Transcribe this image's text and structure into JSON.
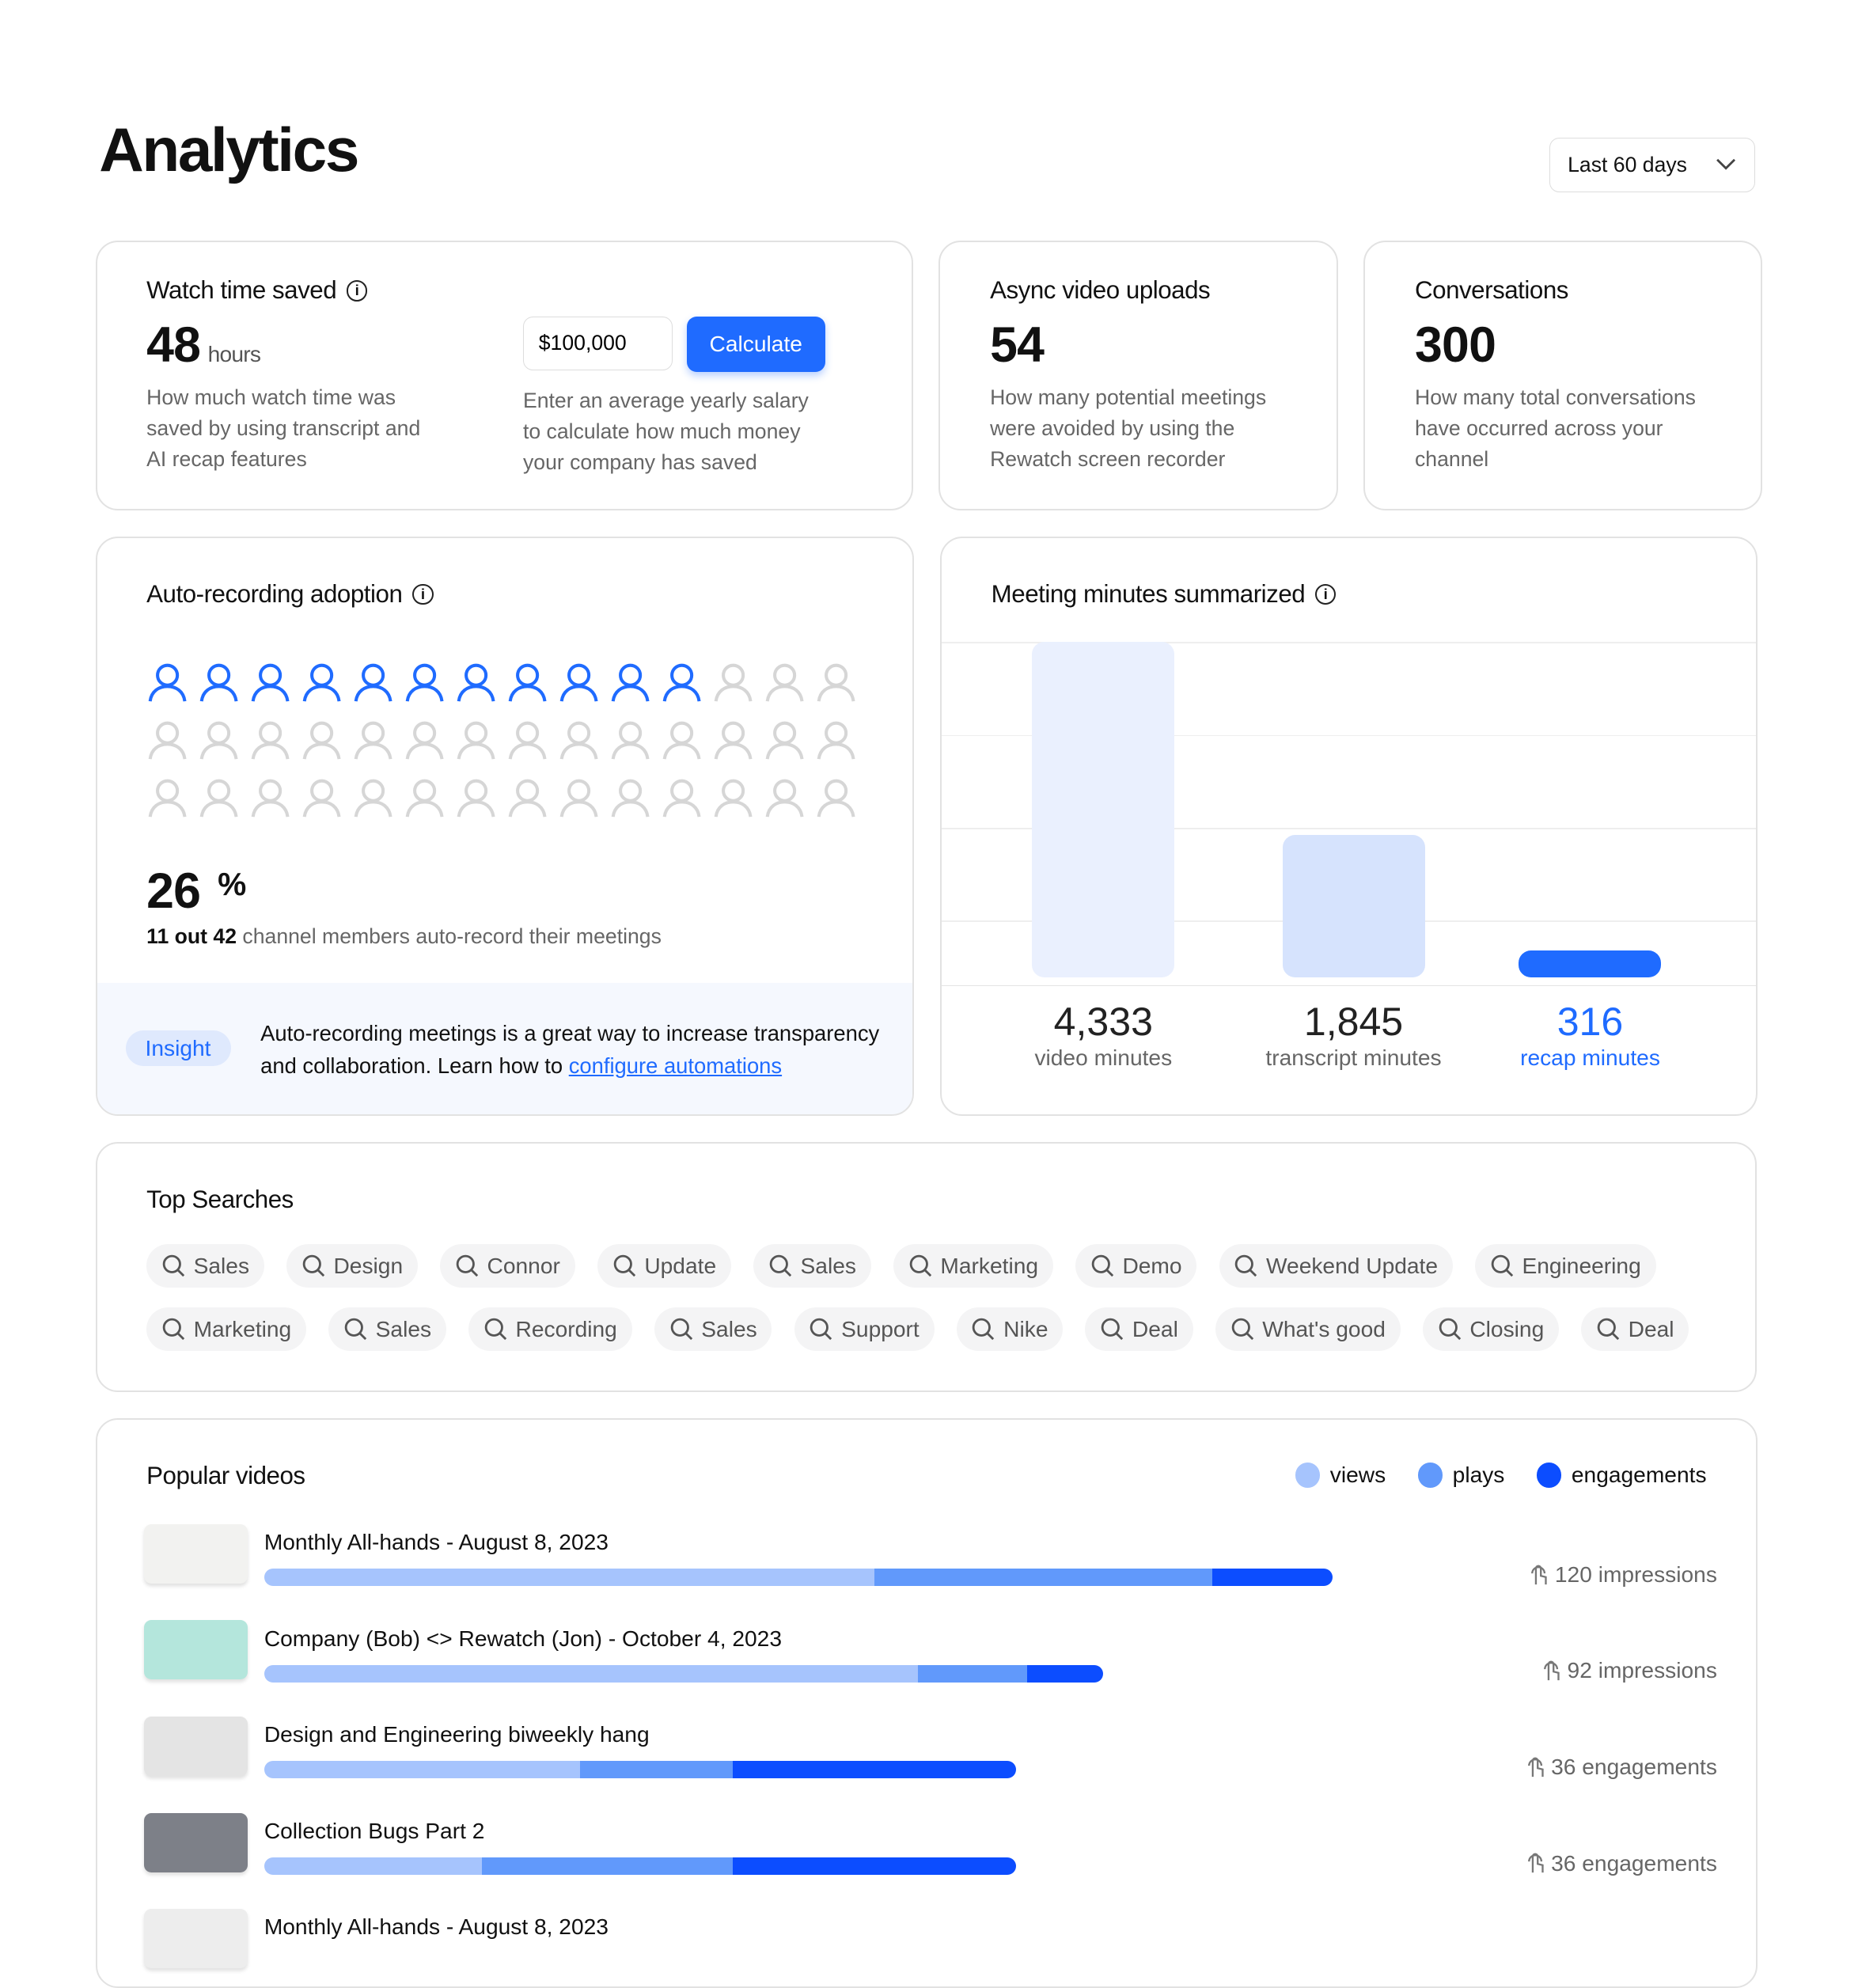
{
  "header": {
    "title": "Analytics",
    "range": "Last 60 days"
  },
  "watch": {
    "title": "Watch time saved",
    "value": "48",
    "unit": "hours",
    "desc": "How much watch time was saved by using transcript and AI recap features",
    "salary": "$100,000",
    "calculate": "Calculate",
    "calc_desc": "Enter an average yearly salary to calculate how much money your company has saved"
  },
  "uploads": {
    "title": "Async video uploads",
    "value": "54",
    "desc": "How many potential meetings were avoided by using the Rewatch screen recorder"
  },
  "conversations": {
    "title": "Conversations",
    "value": "300",
    "desc": "How many total conversations have occurred across your channel"
  },
  "adoption": {
    "title": "Auto-recording adoption",
    "percent": "26",
    "percent_sign": "%",
    "active": 11,
    "total": 42,
    "count_text": "11 out 42",
    "count_suffix": "channel members auto-record their meetings",
    "insight_badge": "Insight",
    "insight_text": "Auto-recording meetings is a great way to increase transparency and collaboration. Learn how to",
    "insight_link": "configure automations",
    "active_color": "#1f6bff",
    "inactive_color": "#d6d6d6"
  },
  "minutes": {
    "title": "Meeting minutes summarized",
    "items": [
      {
        "value": 4333,
        "value_label": "4,333",
        "label": "video minutes",
        "color": "#eaf0fe"
      },
      {
        "value": 1845,
        "value_label": "1,845",
        "label": "transcript minutes",
        "color": "#d6e3fd"
      },
      {
        "value": 316,
        "value_label": "316",
        "label": "recap minutes",
        "color": "#1f6bff"
      }
    ]
  },
  "searches": {
    "title": "Top Searches",
    "items": [
      "Sales",
      "Design",
      "Connor",
      "Update",
      "Sales",
      "Marketing",
      "Demo",
      "Weekend Update",
      "Engineering",
      "Marketing",
      "Sales",
      "Recording",
      "Sales",
      "Support",
      "Nike",
      "Deal",
      "What's good",
      "Closing",
      "Deal"
    ]
  },
  "popular": {
    "title": "Popular videos",
    "legend": [
      {
        "label": "views",
        "color": "#a6c4fd"
      },
      {
        "label": "plays",
        "color": "#6199fb"
      },
      {
        "label": "engagements",
        "color": "#0c4dff"
      }
    ],
    "videos": [
      {
        "title": "Monthly All-hands - August 8, 2023",
        "views": 56,
        "plays": 31,
        "engagements": 11,
        "stat": "120 impressions",
        "thumb": "#f2f2f0"
      },
      {
        "title": "Company (Bob) <> Rewatch (Jon) - October 4, 2023",
        "views": 60,
        "plays": 10,
        "engagements": 7,
        "stat": "92 impressions",
        "thumb": "#b4e6dc"
      },
      {
        "title": "Design and Engineering biweekly hang",
        "views": 29,
        "plays": 14,
        "engagements": 26,
        "stat": "36 engagements",
        "thumb": "#e4e4e4"
      },
      {
        "title": "Collection Bugs Part 2",
        "views": 20,
        "plays": 23,
        "engagements": 26,
        "stat": "36 engagements",
        "thumb": "#7d8088"
      },
      {
        "title": "Monthly All-hands - August 8, 2023",
        "views": 0,
        "plays": 0,
        "engagements": 0,
        "stat": "",
        "thumb": "#ededed"
      }
    ]
  }
}
